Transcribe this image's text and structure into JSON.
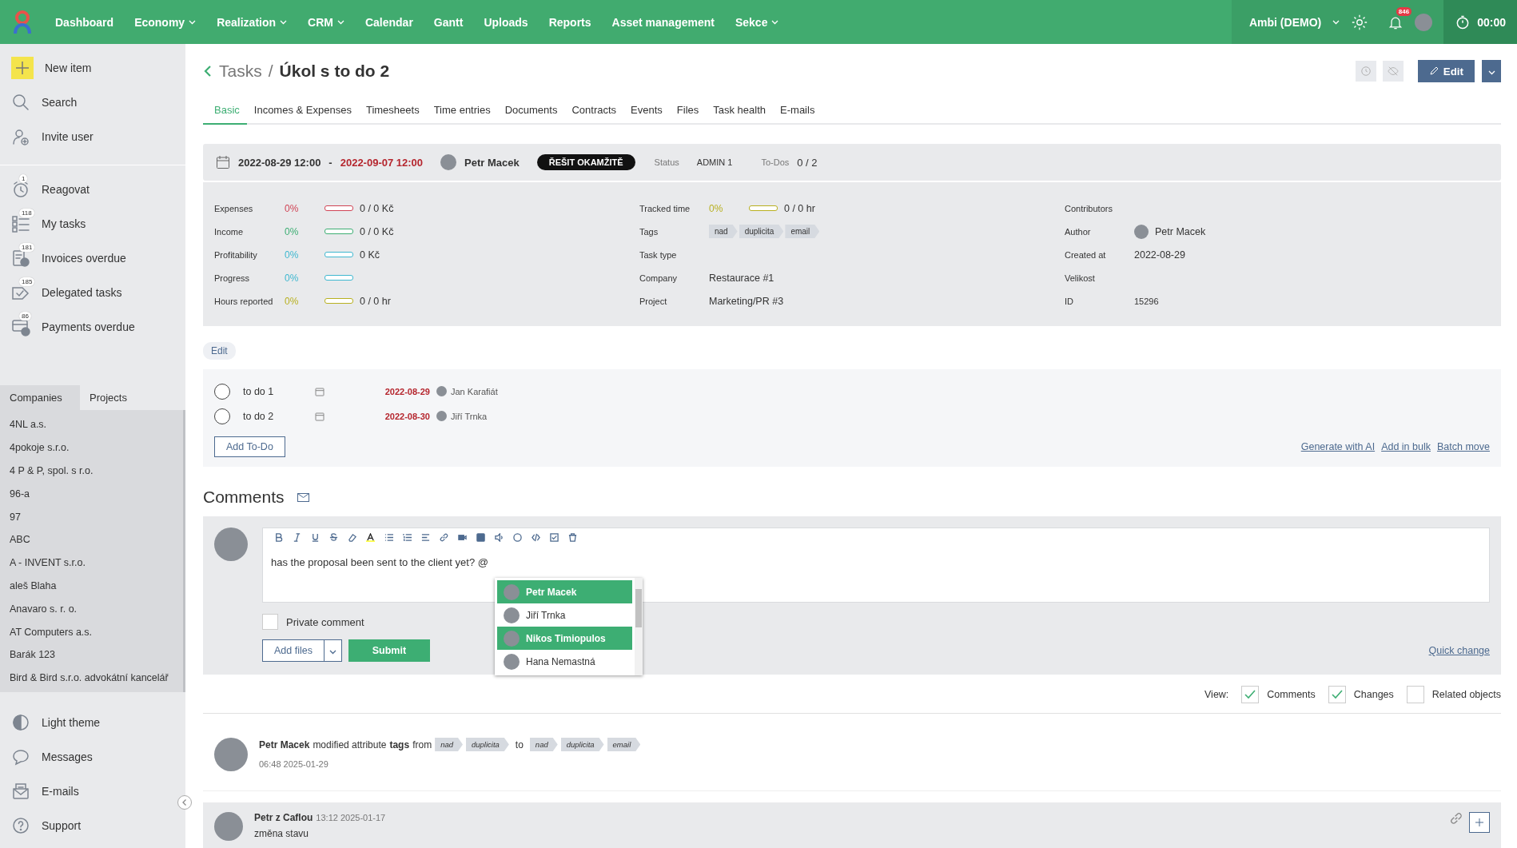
{
  "nav": {
    "items": [
      {
        "label": "Dashboard",
        "dropdown": false
      },
      {
        "label": "Economy",
        "dropdown": true
      },
      {
        "label": "Realization",
        "dropdown": true
      },
      {
        "label": "CRM",
        "dropdown": true
      },
      {
        "label": "Calendar",
        "dropdown": false
      },
      {
        "label": "Gantt",
        "dropdown": false
      },
      {
        "label": "Uploads",
        "dropdown": false
      },
      {
        "label": "Reports",
        "dropdown": false
      },
      {
        "label": "Asset management",
        "dropdown": false
      },
      {
        "label": "Sekce",
        "dropdown": true
      }
    ],
    "account": "Ambi (DEMO)",
    "notifications": "846",
    "timer": "00:00"
  },
  "sidebar": {
    "actions": [
      {
        "label": "New item",
        "kind": "plus"
      },
      {
        "label": "Search",
        "kind": "search"
      },
      {
        "label": "Invite user",
        "kind": "invite"
      }
    ],
    "shortcuts": [
      {
        "label": "Reagovat",
        "badge": "1",
        "kind": "alarm"
      },
      {
        "label": "My tasks",
        "badge": "118",
        "kind": "list"
      },
      {
        "label": "Invoices overdue",
        "badge": "181",
        "kind": "invoice"
      },
      {
        "label": "Delegated tasks",
        "badge": "185",
        "kind": "delegate"
      },
      {
        "label": "Payments overdue",
        "badge": "86",
        "kind": "payment"
      }
    ],
    "tabs": [
      {
        "label": "Companies",
        "selected": true
      },
      {
        "label": "Projects",
        "selected": false
      }
    ],
    "companies": [
      "4NL a.s.",
      "4pokoje s.r.o.",
      "4 P & P, spol. s r.o.",
      "96-a",
      "97",
      "ABC",
      "A - INVENT s.r.o.",
      "aleš Blaha",
      "Anavaro s. r. o.",
      "AT Computers a.s.",
      "Barák 123",
      "Bird & Bird s.r.o. advokátní kancelář"
    ],
    "bottom": [
      {
        "label": "Light theme",
        "kind": "theme"
      },
      {
        "label": "Messages",
        "kind": "chat"
      },
      {
        "label": "E-mails",
        "kind": "mail"
      },
      {
        "label": "Support",
        "kind": "help"
      }
    ]
  },
  "header": {
    "breadcrumb": "Tasks",
    "separator": "/",
    "title": "Úkol s to do 2",
    "edit": "Edit"
  },
  "tabs": [
    {
      "label": "Basic",
      "selected": true
    },
    {
      "label": "Incomes & Expenses",
      "selected": false
    },
    {
      "label": "Timesheets",
      "selected": false
    },
    {
      "label": "Time entries",
      "selected": false
    },
    {
      "label": "Documents",
      "selected": false
    },
    {
      "label": "Contracts",
      "selected": false
    },
    {
      "label": "Events",
      "selected": false
    },
    {
      "label": "Files",
      "selected": false
    },
    {
      "label": "Task health",
      "selected": false
    },
    {
      "label": "E-mails",
      "selected": false
    }
  ],
  "summary": {
    "start": "2022-08-29 12:00",
    "separator": "-",
    "end": "2022-09-07 12:00",
    "owner": "Petr Macek",
    "priority": "ŘEŠIT OKAMŽITĚ",
    "status_label": "Status",
    "status": "ADMIN 1",
    "todos_label": "To-Dos",
    "todos": "0 / 2"
  },
  "metrics": [
    {
      "label": "Expenses",
      "percent": "0%",
      "value": "0 / 0 Kč",
      "color": "#d04455",
      "level": 0
    },
    {
      "label": "Income",
      "percent": "0%",
      "value": "0 / 0 Kč",
      "color": "#3dae73",
      "level": 0
    },
    {
      "label": "Profitability",
      "percent": "0%",
      "value": "0 Kč",
      "color": "#3fb8d0",
      "level": 0
    },
    {
      "label": "Progress",
      "percent": "0%",
      "color": "#3fb8d0",
      "level": 0
    },
    {
      "label": "Hours reported",
      "percent": "0%",
      "value": "0 / 0 hr",
      "color": "#b8b020",
      "level": 0
    }
  ],
  "middle": [
    {
      "kind": "metric",
      "label": "Tracked time",
      "percent": "0%",
      "value": "0 / 0 hr",
      "color": "#b8b020",
      "level": 0
    },
    {
      "kind": "tags",
      "label": "Tags",
      "tags": [
        "nad",
        "duplicita",
        "email"
      ]
    },
    {
      "kind": "text",
      "label": "Task type"
    },
    {
      "kind": "text",
      "label": "Company",
      "value": "Restaurace #1"
    },
    {
      "kind": "text",
      "label": "Project",
      "value": "Marketing/PR #3"
    }
  ],
  "right": [
    {
      "kind": "text",
      "label": "Contributors"
    },
    {
      "kind": "person",
      "label": "Author",
      "value": "Petr Macek"
    },
    {
      "kind": "text",
      "label": "Created at",
      "value": "2022-08-29"
    },
    {
      "kind": "text",
      "label": "Velikost"
    },
    {
      "kind": "small",
      "label": "ID",
      "value": "15296"
    }
  ],
  "edit_link": "Edit",
  "todos": [
    {
      "label": "to do 1",
      "checked": false,
      "date": "2022-08-29",
      "assignee": "Jan Karafiát"
    },
    {
      "label": "to do 2",
      "checked": false,
      "date": "2022-08-30",
      "assignee": "Jiří Trnka"
    }
  ],
  "todo_actions": {
    "add": "Add To-Do",
    "links": [
      "Generate with AI",
      "Add in bulk",
      "Batch move"
    ]
  },
  "comments": {
    "title": "Comments",
    "text": "has the proposal been sent to the client yet? @",
    "mentions": [
      {
        "name": "Petr Macek",
        "selected": true
      },
      {
        "name": "Jiří Trnka",
        "selected": false
      },
      {
        "name": "Nikos Timiopulos",
        "selected": true
      },
      {
        "name": "Hana Nemastná",
        "selected": false
      }
    ],
    "private": {
      "label": "Private comment",
      "checked": false
    },
    "add_files": "Add files",
    "submit": "Submit",
    "quick_change": "Quick change"
  },
  "view": {
    "label": "View:",
    "options": [
      {
        "label": "Comments",
        "checked": true
      },
      {
        "label": "Changes",
        "checked": true
      },
      {
        "label": "Related objects",
        "checked": false
      }
    ]
  },
  "activity": [
    {
      "kind": "change",
      "author": "Petr Macek",
      "action": "modified attribute",
      "attribute": "tags",
      "from_word": "from",
      "from": [
        "nad",
        "duplicita"
      ],
      "to_word": "to",
      "to": [
        "nad",
        "duplicita",
        "email"
      ],
      "time": "06:48 2025-01-29"
    },
    {
      "kind": "comment",
      "author": "Petr z Caflou",
      "time": "13:12 2025-01-17",
      "text": "změna stavu"
    }
  ]
}
